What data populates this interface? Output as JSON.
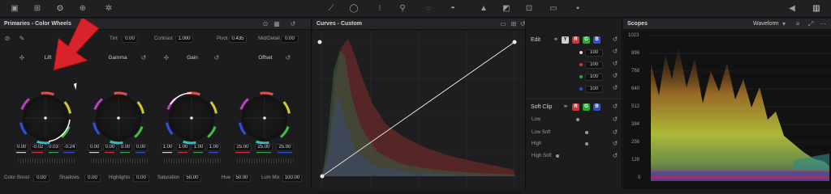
{
  "colors": {
    "accent_red": "#d8232a",
    "wheel_bg": "#1a1a1a",
    "red_channel": "#d83232",
    "green_channel": "#2fa53a",
    "blue_channel": "#2f4fd8",
    "y_channel": "#cfcfcf"
  },
  "toolbar": {
    "icons": [
      "camera-raw-icon",
      "color-match-icon",
      "color-wheels-icon",
      "rgb-mixer-icon",
      "motion-effects-icon",
      "curves-icon",
      "window-icon",
      "tracker-icon",
      "qualifier-icon",
      "power-window-icon",
      "magic-mask-icon",
      "blur-icon",
      "key-icon",
      "sizing-icon",
      "3d-icon",
      "keyframes-icon",
      "scopes-toggle-icon",
      "info-icon"
    ]
  },
  "primaries": {
    "title": "Primaries - Color Wheels",
    "top_params": [
      {
        "label": "Tint",
        "value": "0.00"
      },
      {
        "label": "Contrast",
        "value": "1.000"
      },
      {
        "label": "Pivot",
        "value": "0.435"
      },
      {
        "label": "Mid/Detail",
        "value": "0.00"
      }
    ],
    "wheels": [
      {
        "name": "Lift",
        "values": [
          "0.00",
          "-0.02",
          "0.03",
          "-0.24"
        ]
      },
      {
        "name": "Gamma",
        "values": [
          "0.00",
          "0.00",
          "0.00",
          "0.00"
        ]
      },
      {
        "name": "Gain",
        "values": [
          "1.00",
          "1.00",
          "1.00",
          "1.00"
        ]
      },
      {
        "name": "Offset",
        "values": [
          "25.00",
          "25.00",
          "25.00"
        ]
      }
    ],
    "bottom_params": [
      {
        "label": "Color Boost",
        "value": "0.00"
      },
      {
        "label": "Shadows",
        "value": "0.00"
      },
      {
        "label": "Highlights",
        "value": "0.00"
      },
      {
        "label": "Saturation",
        "value": "50.00"
      },
      {
        "label": "Hue",
        "value": "50.00"
      },
      {
        "label": "Lum Mix",
        "value": "100.00"
      }
    ]
  },
  "curves": {
    "title": "Curves - Custom"
  },
  "edit": {
    "label": "Edit",
    "channel_buttons": [
      "Y",
      "R",
      "G",
      "B"
    ],
    "channel_values": [
      {
        "dot": "#d8d8d8",
        "value": "100"
      },
      {
        "dot": "#d83232",
        "value": "100"
      },
      {
        "dot": "#2fa53a",
        "value": "100"
      },
      {
        "dot": "#2f4fd8",
        "value": "100"
      }
    ],
    "soft_clip_label": "Soft Clip",
    "soft_clip_buttons": [
      "R",
      "G",
      "B"
    ],
    "soft_clip_rows": [
      "Low",
      "Low Soft",
      "High",
      "High Soft"
    ]
  },
  "scopes": {
    "title": "Scopes",
    "mode": "Waveform",
    "scale": [
      "1023",
      "896",
      "768",
      "640",
      "512",
      "384",
      "256",
      "128",
      "0"
    ]
  }
}
